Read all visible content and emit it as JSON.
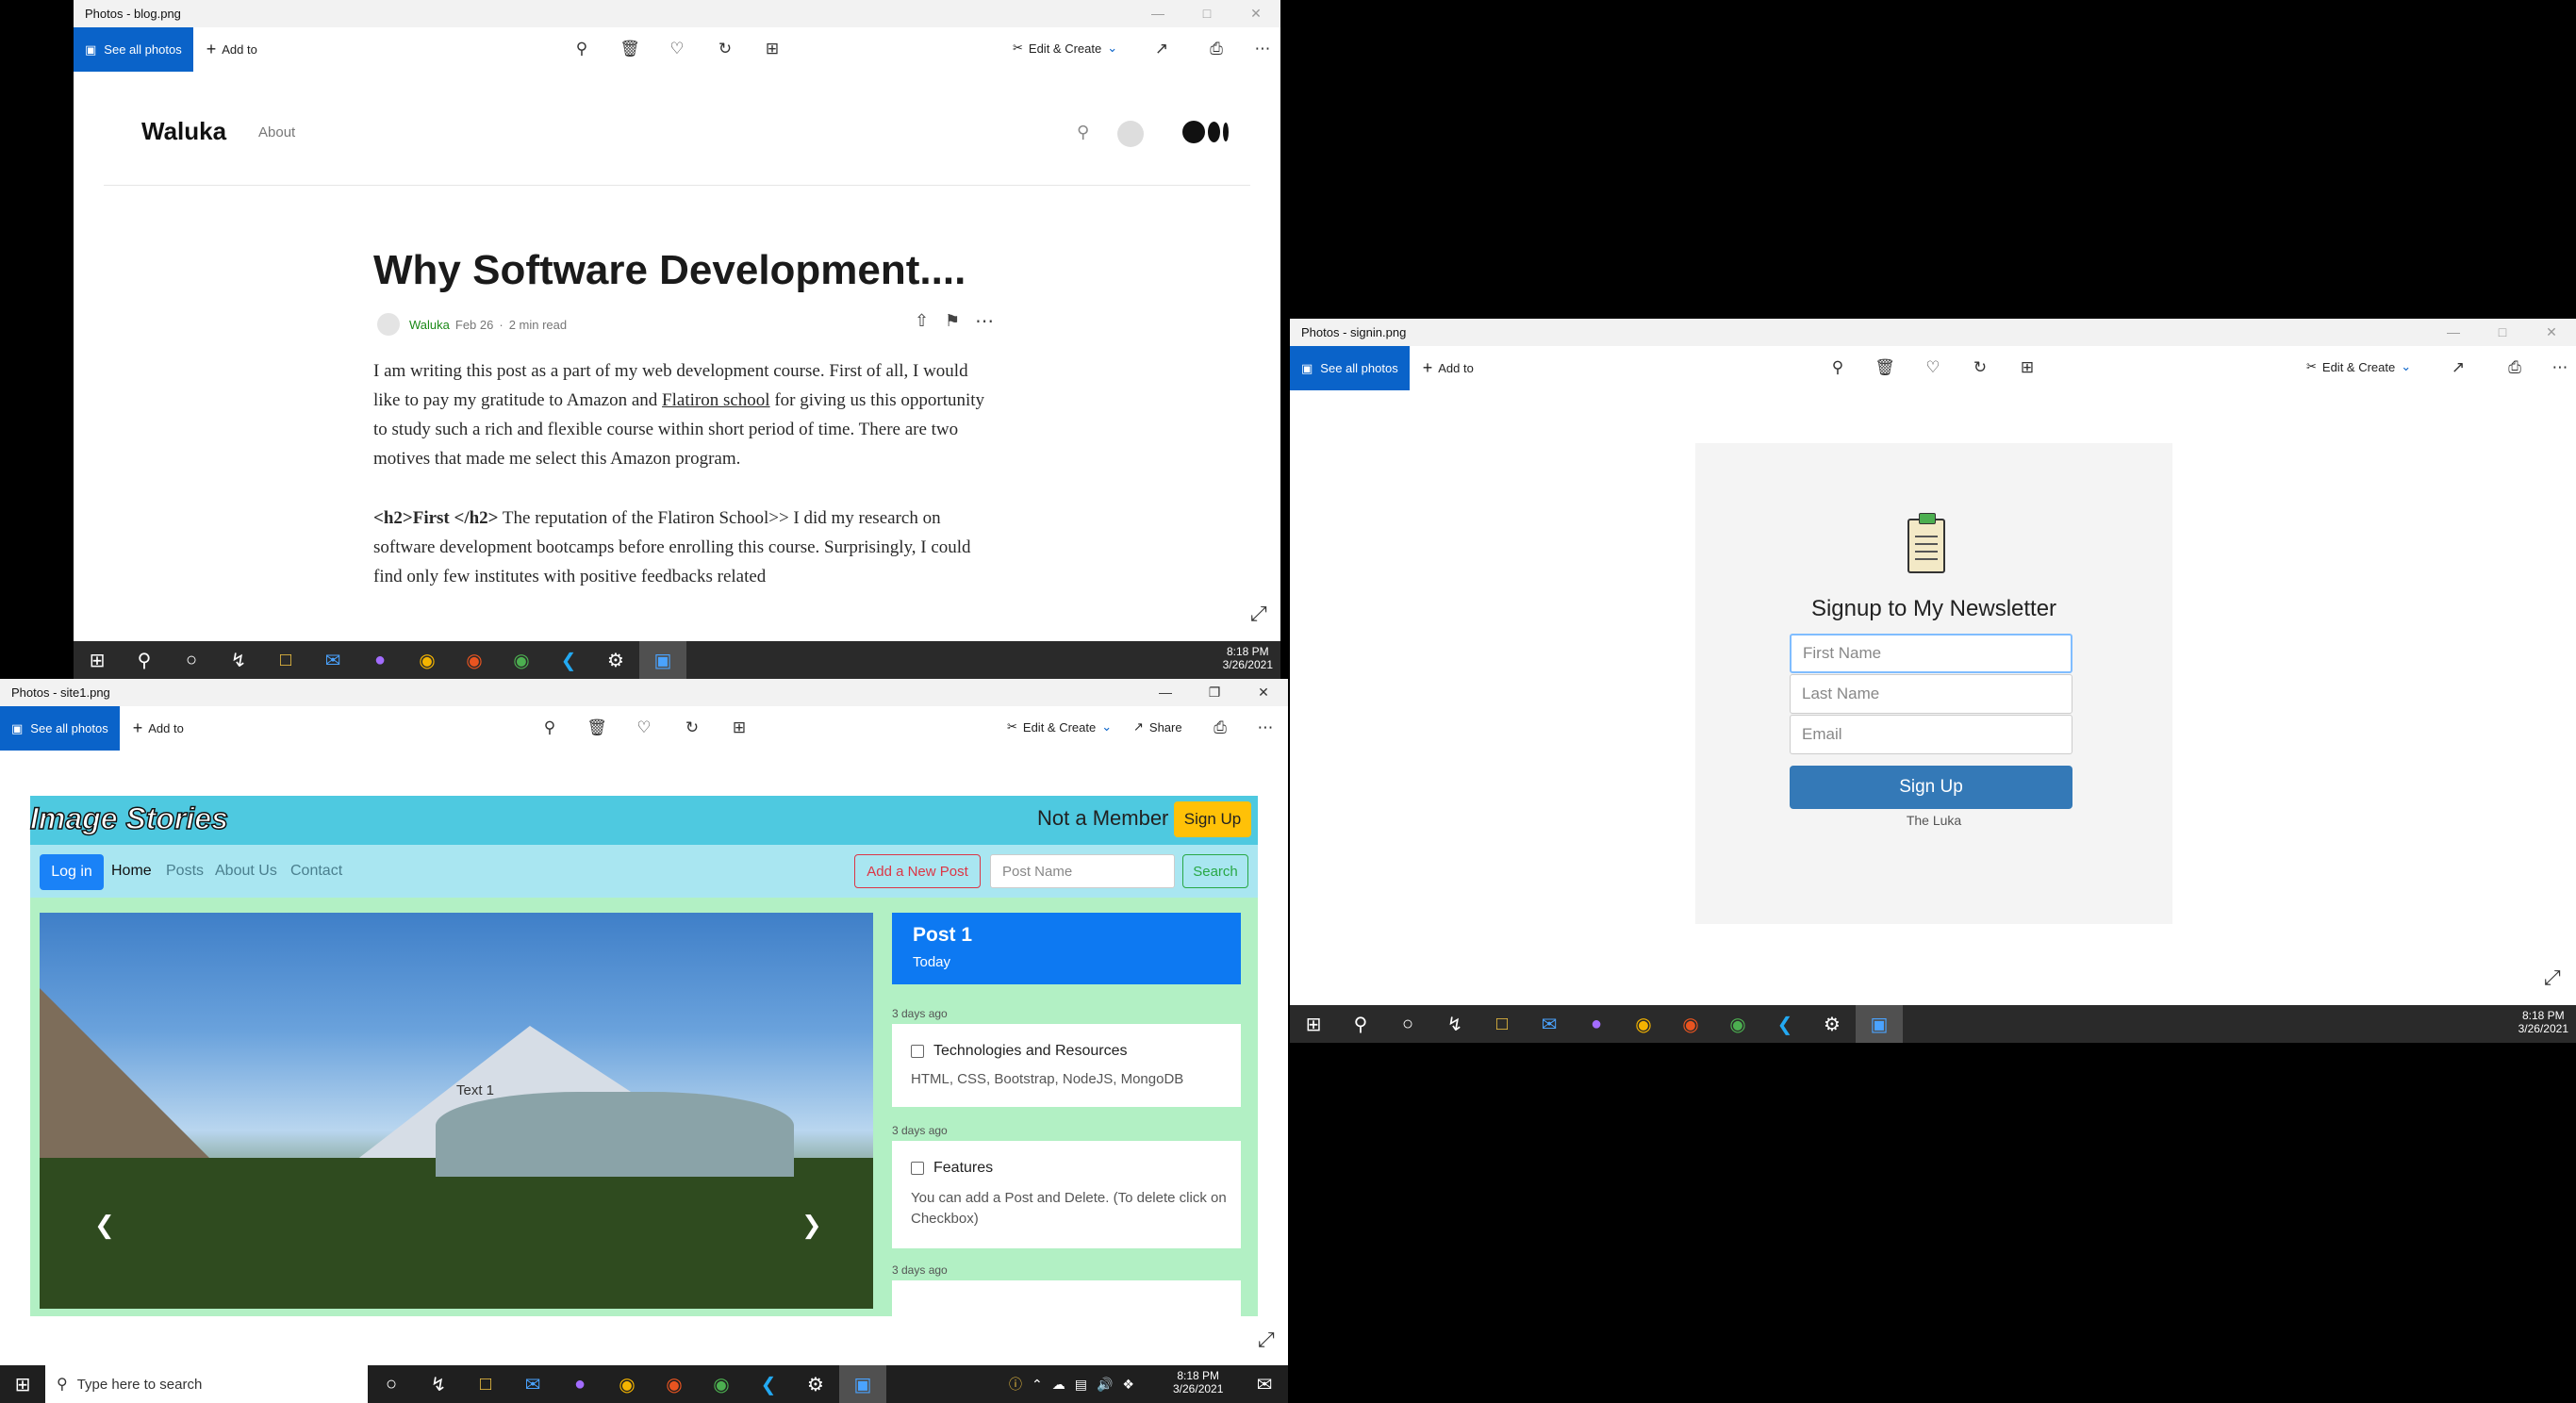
{
  "toolbar_common": {
    "see_all": "See all photos",
    "add_to": "Add to",
    "edit_create": "Edit & Create",
    "share": "Share"
  },
  "blog_window": {
    "title": "Photos - blog.png",
    "site_name": "Waluka",
    "nav_about": "About",
    "post_title": "Why Software Development....",
    "author": "Waluka",
    "date": "Feb 26",
    "read_time": "2 min read",
    "para1_a": "I am writing this post as a part of my web development course. First of all, I would like to pay my gratitude to Amazon and ",
    "para1_link": "Flatiron school",
    "para1_b": " for giving us this opportunity to study such a rich and flexible course within short period of time. There are two motives that made me select this Amazon program.",
    "para2_bold": "<h2>First </h2>",
    "para2_text": " The reputation of the Flatiron School>> I did my research on software development bootcamps before enrolling this course. Surprisingly, I could find only few institutes with positive feedbacks related",
    "clock_time": "8:18 PM",
    "clock_date": "3/26/2021"
  },
  "signin_window": {
    "title": "Photos - signin.png",
    "heading": "Signup to My Newsletter",
    "first_name_ph": "First Name",
    "last_name_ph": "Last Name",
    "email_ph": "Email",
    "signup_btn": "Sign Up",
    "footer": "The Luka",
    "clock_time": "8:18 PM",
    "clock_date": "3/26/2021"
  },
  "site_window": {
    "title": "Photos - site1.png",
    "logo": "Image Stories",
    "not_member": "Not a Member",
    "signup_btn": "Sign Up",
    "login_btn": "Log in",
    "nav": [
      "Home",
      "Posts",
      "About Us",
      "Contact"
    ],
    "add_post_btn": "Add a New Post",
    "post_name_ph": "Post Name",
    "search_btn": "Search",
    "carousel_caption": "Text 1",
    "post_header_title": "Post 1",
    "post_header_sub": "Today",
    "posts": [
      {
        "age": "3 days ago",
        "title": "Technologies and Resources",
        "body": "HTML, CSS, Bootstrap, NodeJS, MongoDB"
      },
      {
        "age": "3 days ago",
        "title": "Features",
        "body": "You can add a Post and Delete. (To delete click on Checkbox)"
      },
      {
        "age": "3 days ago"
      }
    ]
  },
  "main_taskbar": {
    "search_placeholder": "Type here to search",
    "clock_time": "8:18 PM",
    "clock_date": "3/26/2021"
  }
}
